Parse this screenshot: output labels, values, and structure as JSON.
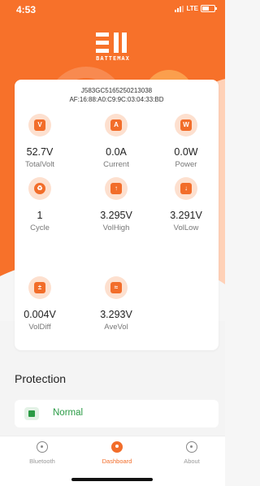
{
  "status_bar": {
    "time": "4:53",
    "network": "LTE"
  },
  "brand": {
    "name": "BATTEMAX",
    "accent": "#f26d2a"
  },
  "device": {
    "serial": "J583GC5165250213038",
    "mac": "AF:16:88:A0:C9:9C:03:04:33:BD"
  },
  "metrics": [
    {
      "value": "52.7V",
      "label": "TotalVolt",
      "icon": "voltmeter-icon",
      "glyph": "V"
    },
    {
      "value": "0.0A",
      "label": "Current",
      "icon": "ammeter-icon",
      "glyph": "A"
    },
    {
      "value": "0.0W",
      "label": "Power",
      "icon": "power-meter-icon",
      "glyph": "W"
    },
    {
      "value": "1",
      "label": "Cycle",
      "icon": "recycle-icon",
      "glyph": "♻"
    },
    {
      "value": "3.295V",
      "label": "VolHigh",
      "icon": "cell-high-icon",
      "glyph": "↑"
    },
    {
      "value": "3.291V",
      "label": "VolLow",
      "icon": "cell-low-icon",
      "glyph": "↓"
    },
    {
      "value": "0.004V",
      "label": "VolDiff",
      "icon": "cell-diff-icon",
      "glyph": "±"
    },
    {
      "value": "3.293V",
      "label": "AveVol",
      "icon": "battery-average-icon",
      "glyph": "≈"
    }
  ],
  "protection": {
    "title": "Protection",
    "status": "Normal",
    "status_color": "#2a9b45"
  },
  "tabs": [
    {
      "label": "Bluetooth",
      "icon": "bluetooth-icon",
      "active": false
    },
    {
      "label": "Dashboard",
      "icon": "dashboard-icon",
      "active": true
    },
    {
      "label": "About",
      "icon": "about-icon",
      "active": false
    }
  ]
}
